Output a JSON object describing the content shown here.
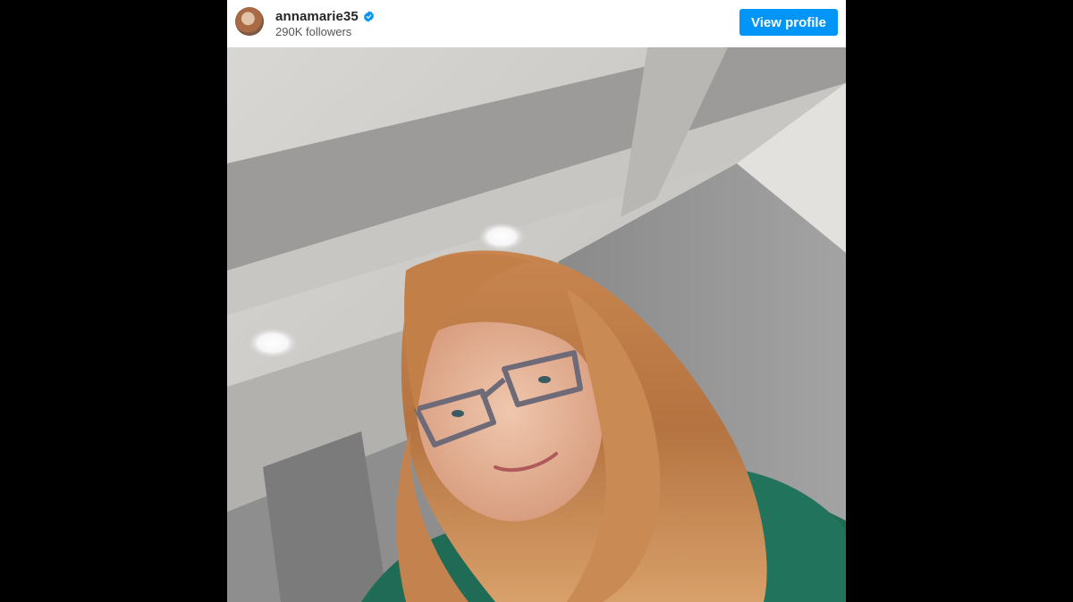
{
  "post_header": {
    "username": "annamarie35",
    "verified_icon": "verified-badge-icon",
    "followers": "290K followers",
    "view_profile_label": "View profile"
  },
  "photo": {
    "subject": "selfie"
  },
  "colors": {
    "accent": "#0095f6",
    "background": "#000000",
    "card": "#ffffff"
  }
}
